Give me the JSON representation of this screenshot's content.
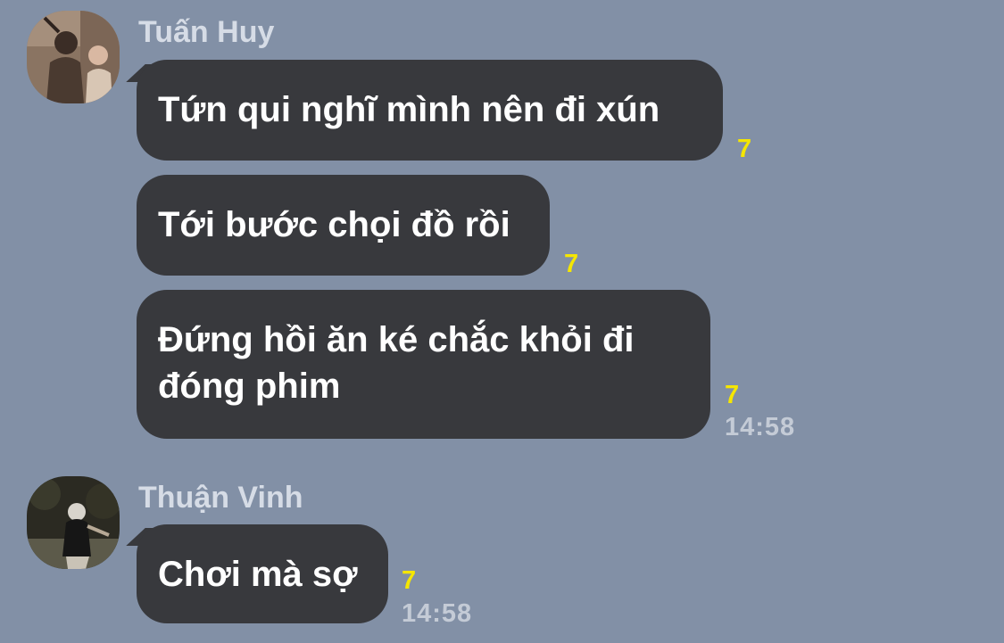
{
  "groups": [
    {
      "sender": "Tuấn Huy",
      "messages": [
        {
          "text": "Tứn qui nghĩ mình nên đi xún",
          "read_count": "7"
        },
        {
          "text": "Tới bước chọi đồ rồi",
          "read_count": "7"
        },
        {
          "text_lines": [
            "Đứng hồi ăn ké chắc khỏi đi",
            "đóng phim"
          ],
          "read_count": "7",
          "time": "14:58"
        }
      ]
    },
    {
      "sender": "Thuận Vinh",
      "messages": [
        {
          "text": "Chơi mà sợ",
          "read_count": "7",
          "time": "14:58"
        }
      ]
    }
  ],
  "colors": {
    "background": "#8290a6",
    "bubble": "#38393d",
    "bubble_text": "#ffffff",
    "read_count": "#f5e600",
    "timestamp": "#c4cbd6",
    "sender_name": "#d6dce6"
  }
}
